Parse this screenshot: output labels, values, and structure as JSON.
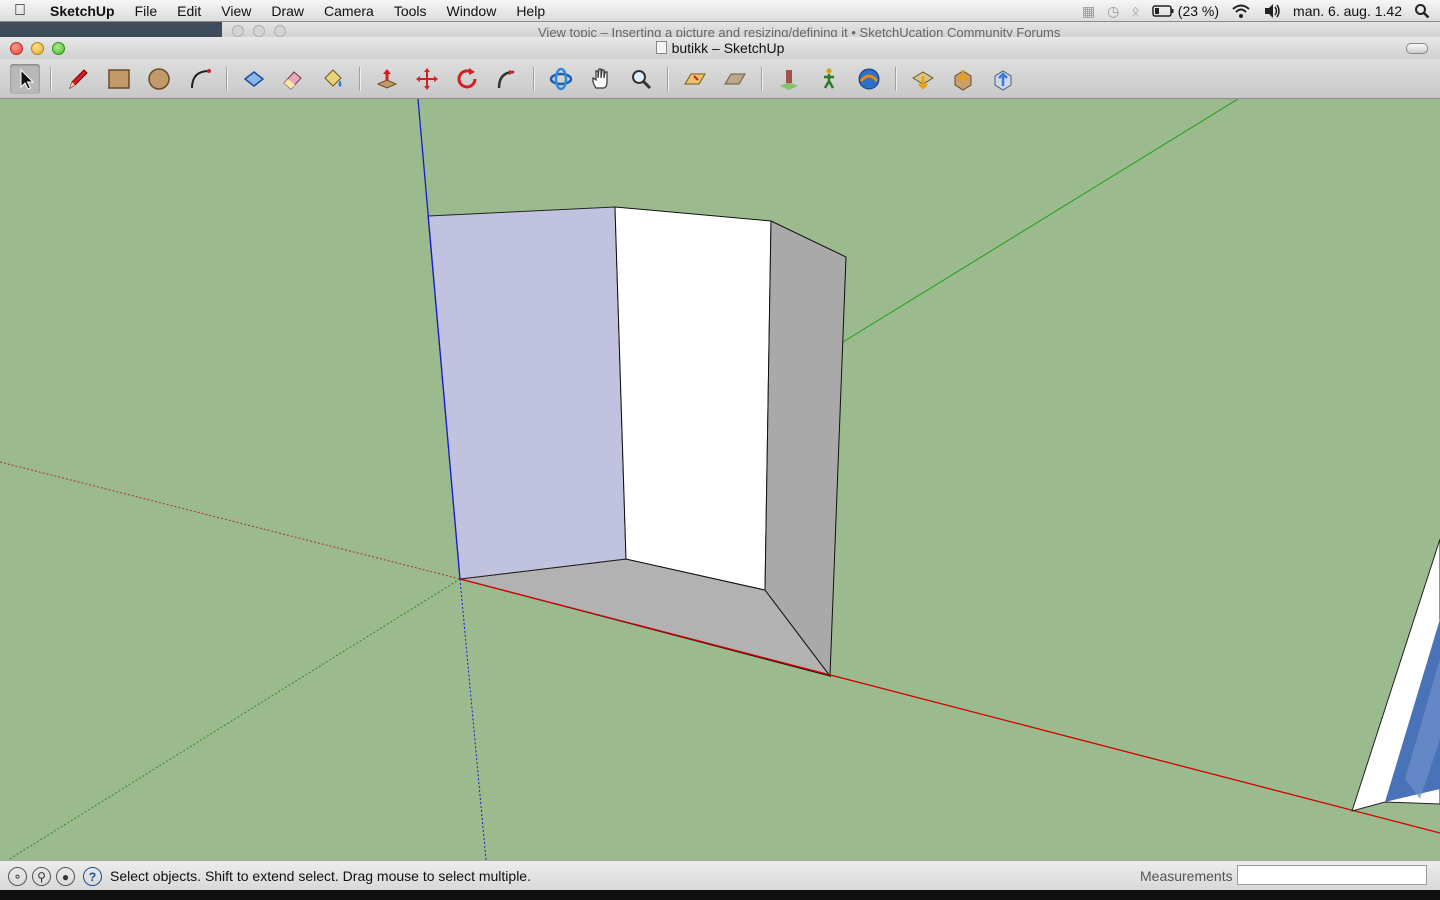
{
  "menubar": {
    "apple_icon": "apple-icon",
    "app_name": "SketchUp",
    "items": [
      "File",
      "Edit",
      "View",
      "Draw",
      "Camera",
      "Tools",
      "Window",
      "Help"
    ],
    "battery": "(23 %)",
    "clock": "man. 6. aug.  1.42"
  },
  "background_window": {
    "title": "View topic – Inserting a picture and resizing/defining it • SketchUcation Community Forums"
  },
  "window": {
    "title": "butikk – SketchUp"
  },
  "toolbar": {
    "tools": [
      {
        "name": "select",
        "icon": "select-arrow-icon",
        "active": true
      },
      {
        "name": "line",
        "icon": "pencil-icon"
      },
      {
        "name": "rectangle",
        "icon": "rectangle-icon"
      },
      {
        "name": "circle",
        "icon": "circle-icon"
      },
      {
        "name": "arc",
        "icon": "arc-icon"
      },
      {
        "name": "make-component",
        "icon": "component-icon"
      },
      {
        "name": "eraser",
        "icon": "eraser-icon"
      },
      {
        "name": "paint-bucket",
        "icon": "paint-bucket-icon"
      },
      {
        "name": "push-pull",
        "icon": "push-pull-icon"
      },
      {
        "name": "move",
        "icon": "move-icon"
      },
      {
        "name": "rotate",
        "icon": "rotate-icon"
      },
      {
        "name": "follow-me",
        "icon": "follow-me-icon"
      },
      {
        "name": "orbit",
        "icon": "orbit-icon"
      },
      {
        "name": "pan",
        "icon": "pan-hand-icon"
      },
      {
        "name": "zoom",
        "icon": "zoom-icon"
      },
      {
        "name": "zoom-extents",
        "icon": "zoom-extents-icon"
      },
      {
        "name": "previous-view",
        "icon": "previous-view-icon"
      },
      {
        "name": "position-camera",
        "icon": "position-camera-icon"
      },
      {
        "name": "walk",
        "icon": "walk-icon"
      },
      {
        "name": "look-around",
        "icon": "look-around-icon"
      },
      {
        "name": "add-location",
        "icon": "add-location-icon"
      },
      {
        "name": "get-models",
        "icon": "get-models-icon"
      },
      {
        "name": "share-model",
        "icon": "share-model-icon"
      }
    ]
  },
  "scene": {
    "axis_colors": {
      "red": "#d40000",
      "green": "#22aa22",
      "blue": "#1a1ad4"
    },
    "face_colors": {
      "left": "#c0c2e0",
      "middle": "#ffffff",
      "right": "#a9a9a9",
      "floor": "#b2b2b2",
      "ground": "#9bbb8e"
    }
  },
  "statusbar": {
    "icons": [
      "geo-location-icon",
      "credits-icon",
      "license-icon",
      "help-icon"
    ],
    "text": "Select objects. Shift to extend select. Drag mouse to select multiple.",
    "measurements_label": "Measurements",
    "measurements_value": ""
  }
}
